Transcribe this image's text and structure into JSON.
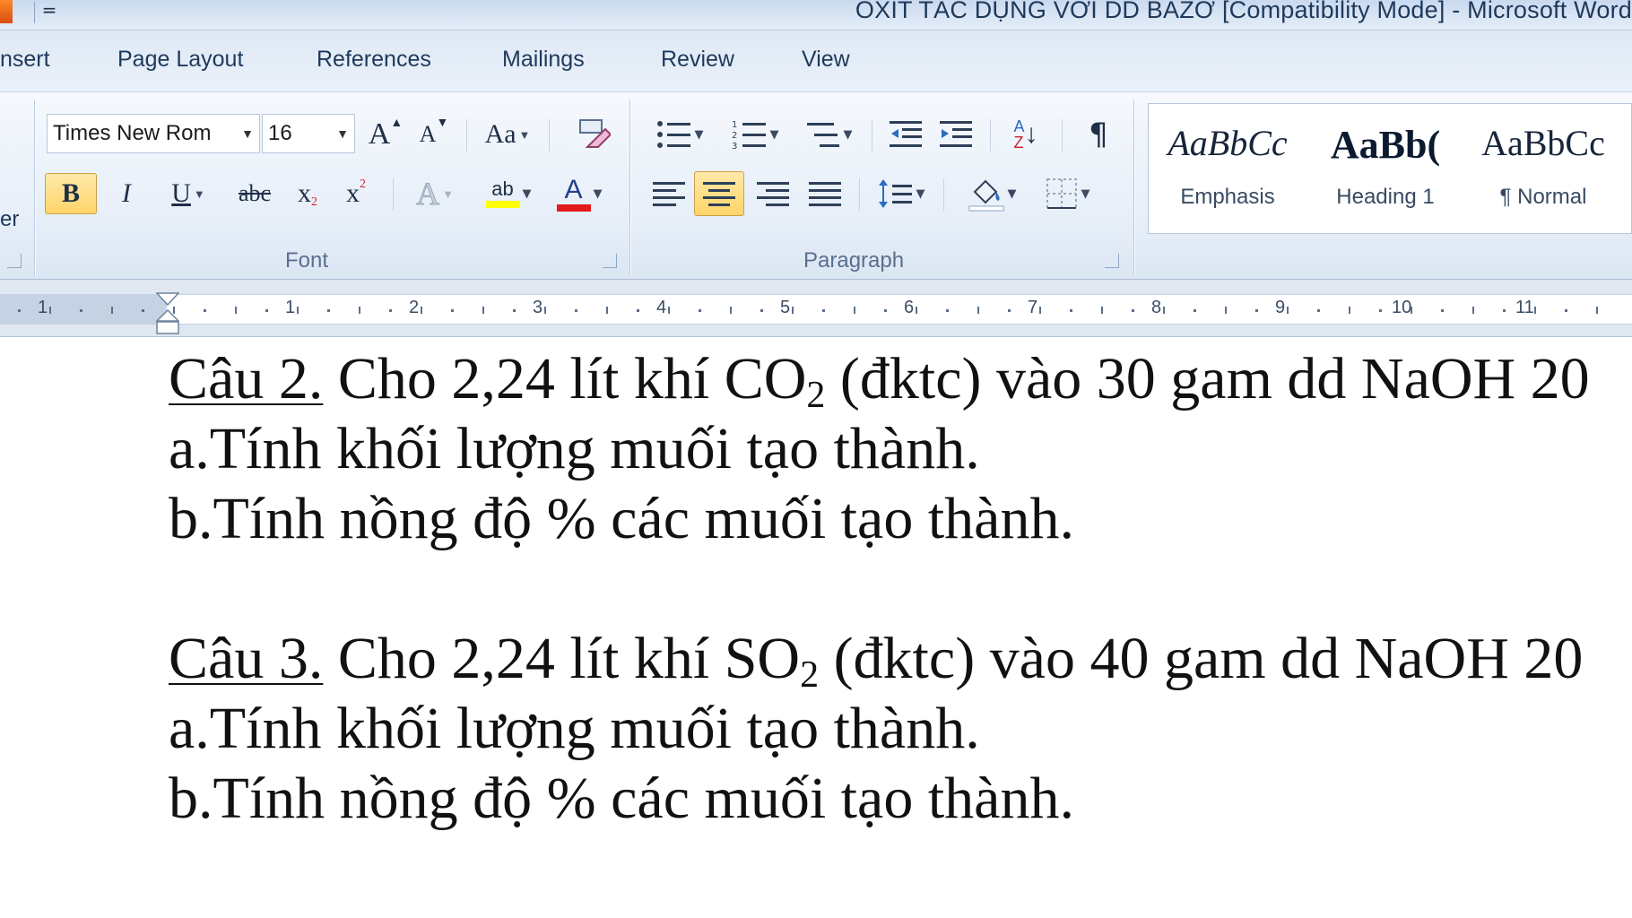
{
  "window": {
    "title": "OXIT TÁC DỤNG VỚI DD BAZƠ [Compatibility Mode]  -  Microsoft Word",
    "qat_dropdown": "="
  },
  "tabs": [
    {
      "label": "nsert"
    },
    {
      "label": "Page Layout"
    },
    {
      "label": "References"
    },
    {
      "label": "Mailings"
    },
    {
      "label": "Review"
    },
    {
      "label": "View"
    }
  ],
  "ribbon": {
    "left_stub": "er",
    "font": {
      "group_label": "Font",
      "font_name": "Times New Rom",
      "font_size": "16",
      "grow_label": "A",
      "shrink_label": "A",
      "change_case_label": "Aa",
      "bold_label": "B",
      "italic_label": "I",
      "underline_label": "U",
      "strike_label": "abc",
      "subscript_label": "x",
      "superscript_label": "x",
      "text_effects_label": "A",
      "highlight_label": "ab",
      "font_color_label": "A"
    },
    "paragraph": {
      "group_label": "Paragraph",
      "pilcrow_label": "¶",
      "sort_label": "A",
      "sort_label2": "Z"
    },
    "styles": [
      {
        "sample": "AaBbCc",
        "name": "Emphasis"
      },
      {
        "sample": "AaBb(",
        "name": "Heading 1"
      },
      {
        "sample": "AaBbCc",
        "name": "¶ Normal"
      }
    ]
  },
  "colors": {
    "accent_active": "#ffd46a",
    "highlight_yellow": "#ffff00",
    "font_color_red": "#e21b1b"
  },
  "ruler": {
    "numbers": [
      "1",
      "1",
      "2",
      "3",
      "4",
      "5",
      "6",
      "7",
      "8",
      "9",
      "10",
      "11"
    ]
  },
  "document": {
    "q2": {
      "label": "Câu 2.",
      "text_a": " Cho 2,24 lít khí CO",
      "sub": "2",
      "text_b": " (đktc) vào 30 gam dd NaOH 20",
      "line_a": "a.Tính khối lượng muối tạo thành.",
      "line_b": "b.Tính nồng độ % các muối tạo thành."
    },
    "q3": {
      "label": "Câu 3.",
      "text_a": " Cho 2,24 lít khí SO",
      "sub": "2",
      "text_b": " (đktc) vào 40 gam dd NaOH 20",
      "line_a": "a.Tính khối lượng muối tạo thành.",
      "line_b": "b.Tính nồng độ % các muối tạo thành."
    }
  }
}
